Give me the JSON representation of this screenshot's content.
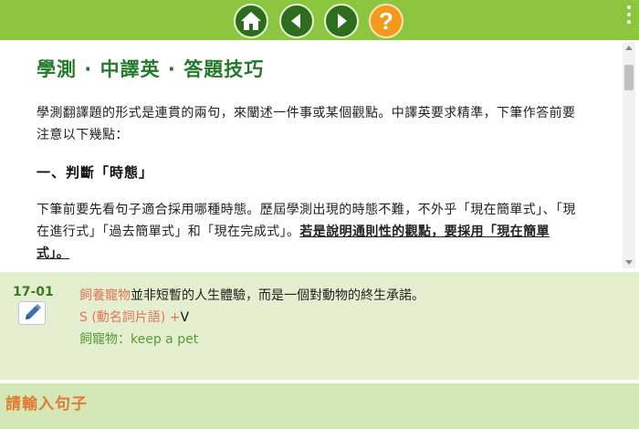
{
  "toolbar": {
    "home_icon": "home-icon",
    "prev_icon": "arrow-left-icon",
    "next_icon": "arrow-right-icon",
    "help_label": "?",
    "menu_icon": "kebab-menu-icon",
    "colors": {
      "bar": "#8cc63f",
      "button": "#2f6d1e",
      "help": "#f39a1d"
    }
  },
  "article": {
    "title": "學測 · 中譯英 · 答題技巧",
    "intro": "學測翻譯題的形式是連貫的兩句，來闡述一件事或某個觀點。中譯英要求精準，下筆作答前要注意以下幾點：",
    "section_heading": "一、判斷「時態」",
    "section_text": "下筆前要先看句子適合採用哪種時態。歷屆學測出現的時態不難，不外乎「現在簡單式」、「現在進行式」「過去簡單式」和「現在完成式」。",
    "section_text_emphasis": "若是說明通則性的觀點，要採用「現在簡單式」。",
    "title_color": "#237a2a"
  },
  "vocab": {
    "number": "17-01",
    "edit_icon": "pencil-edit-icon",
    "highlight_phrase": "飼養寵物",
    "sentence_rest": "並非短暫的人生體驗，而是一個對動物的終生承諾。",
    "pattern_prefix": "S (動名詞片語) +",
    "pattern_verb": "V",
    "gloss": "飼寵物：keep a pet"
  },
  "input": {
    "label": "請輸入句子"
  }
}
